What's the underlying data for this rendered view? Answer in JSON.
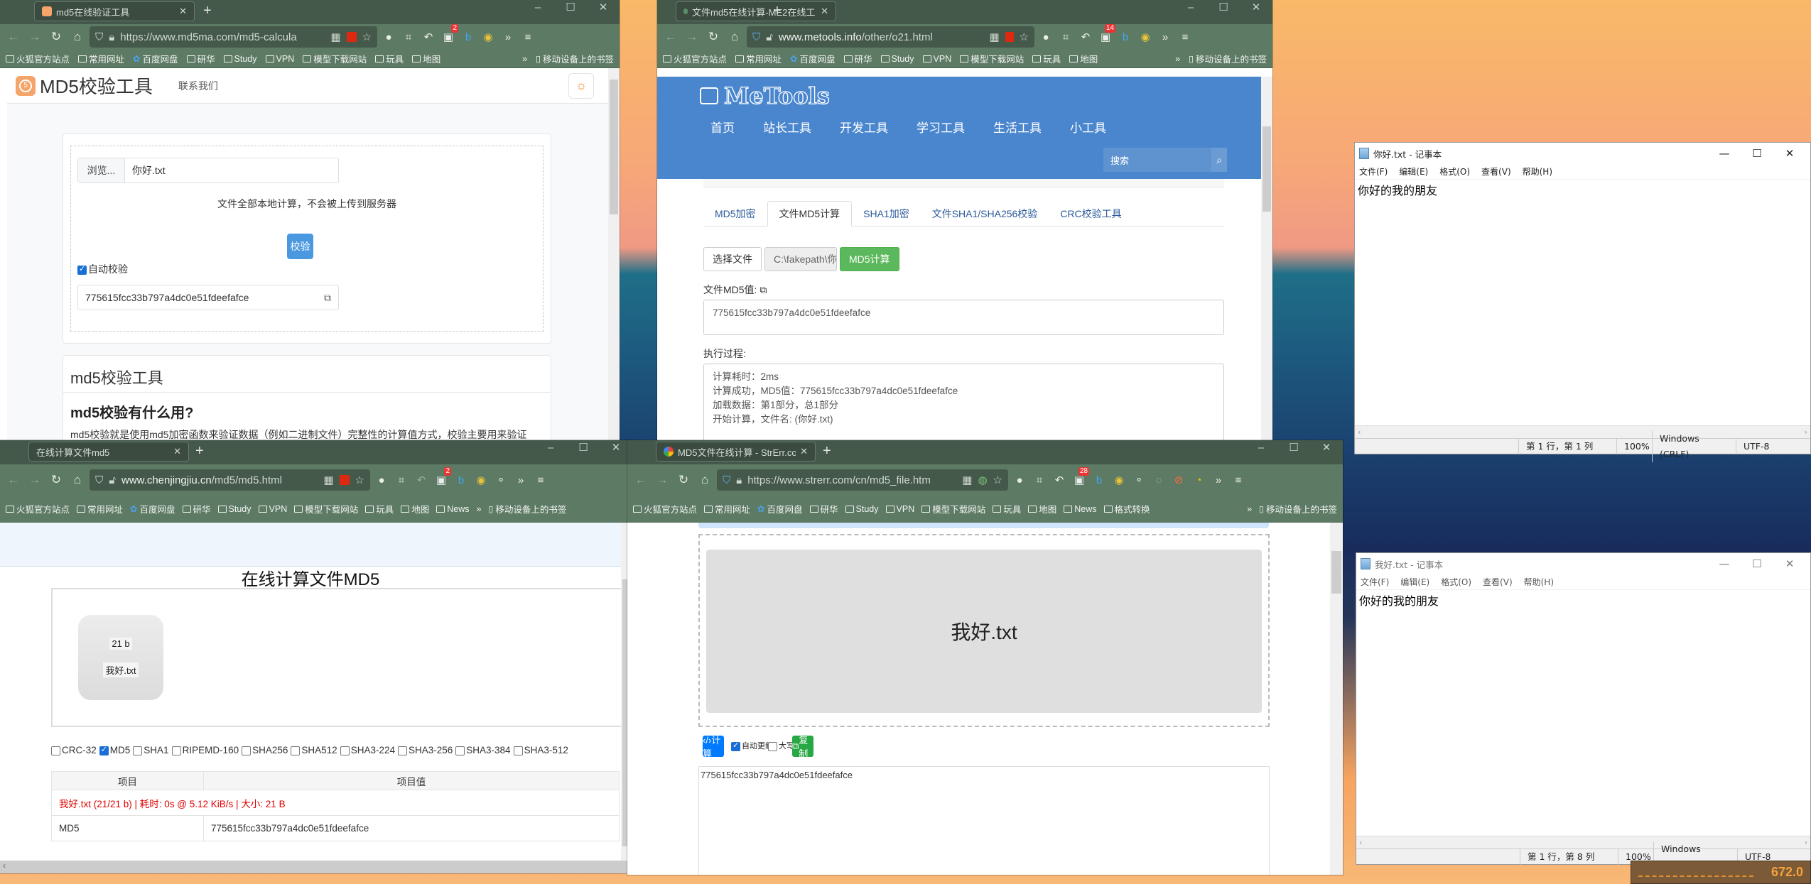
{
  "bookmarks_common": [
    "火狐官方站点",
    "常用网址",
    "百度网盘",
    "研华",
    "Study",
    "VPN",
    "模型下载网站",
    "玩具",
    "地图"
  ],
  "mobile_bookmarks": "移动设备上的书签",
  "window_md5ma": {
    "tab_title": "md5在线验证工具",
    "url": "https://www.md5ma.com/md5-calcula",
    "ext_badge": "2",
    "brand": "MD5校验工具",
    "nav_contact": "联系我们",
    "browse_label": "浏览...",
    "file_name": "你好.txt",
    "local_note": "文件全部本地计算，不会被上传到服务器",
    "verify_button": "校验",
    "auto_verify_label": "自动校验",
    "auto_verify_checked": true,
    "md5_result": "775615fcc33b797a4dc0e51fdeefafce",
    "section_title": "md5校验工具",
    "faq_heading": "md5校验有什么用?",
    "faq_text": "md5校验就是使用md5加密函数来验证数据（例如二进制文件）完整性的计算值方式，校验主要用来验证"
  },
  "window_metools": {
    "tab_title": "文件md5在线计算-ME2在线工",
    "url_host": "www.metools.info",
    "url_path": "/other/o21.html",
    "ext_badge": "14",
    "logo": "MeTools",
    "nav": [
      "首页",
      "站长工具",
      "开发工具",
      "学习工具",
      "生活工具",
      "小工具"
    ],
    "search_placeholder": "搜索",
    "tabs": [
      "MD5加密",
      "文件MD5计算",
      "SHA1加密",
      "文件SHA1/SHA256校验",
      "CRC校验工具"
    ],
    "active_tab": "文件MD5计算",
    "choose_file": "选择文件",
    "file_path": "C:\\fakepath\\你好.txt",
    "compute_button": "MD5计算",
    "md5_label": "文件MD5值:",
    "md5_value": "775615fcc33b797a4dc0e51fdeefafce",
    "process_label": "执行过程:",
    "process_lines": [
      "计算耗时：2ms",
      "计算成功，MD5值：775615fcc33b797a4dc0e51fdeefafce",
      "加载数据：第1部分，总1部分",
      "开始计算，文件名: (你好.txt)"
    ]
  },
  "notepad_1": {
    "title": "你好.txt - 记事本",
    "menu": [
      "文件(F)",
      "编辑(E)",
      "格式(O)",
      "查看(V)",
      "帮助(H)"
    ],
    "content": "你好的我的朋友",
    "status_pos": "第 1 行，第 1 列",
    "zoom": "100%",
    "line_ending": "Windows (CRLF)",
    "encoding": "UTF-8"
  },
  "notepad_2": {
    "title": "我好.txt - 记事本",
    "menu": [
      "文件(F)",
      "编辑(E)",
      "格式(O)",
      "查看(V)",
      "帮助(H)"
    ],
    "content": "你好的我的朋友",
    "status_pos": "第 1 行，第 8 列",
    "zoom": "100%",
    "line_ending": "Windows (CRLF)",
    "encoding": "UTF-8"
  },
  "window_chenjingjiu": {
    "tab_title": "在线计算文件md5",
    "url_host": "www.chenjingjiu.cn",
    "url_path": "/md5/md5.html",
    "ext_badge": "2",
    "extra_bookmark": "News",
    "page_title": "在线计算文件MD5",
    "file_size": "21 b",
    "file_name": "我好.txt",
    "algorithms": [
      {
        "label": "CRC-32",
        "checked": false
      },
      {
        "label": "MD5",
        "checked": true
      },
      {
        "label": "SHA1",
        "checked": false
      },
      {
        "label": "RIPEMD-160",
        "checked": false
      },
      {
        "label": "SHA256",
        "checked": false
      },
      {
        "label": "SHA512",
        "checked": false
      },
      {
        "label": "SHA3-224",
        "checked": false
      },
      {
        "label": "SHA3-256",
        "checked": false
      },
      {
        "label": "SHA3-384",
        "checked": false
      },
      {
        "label": "SHA3-512",
        "checked": false
      }
    ],
    "table_headers": [
      "项目",
      "项目值"
    ],
    "summary_row": "我好.txt (21/21 b) | 耗时: 0s @ 5.12 KiB/s | 大小: 21 B",
    "rows": [
      {
        "item": "MD5",
        "value": "775615fcc33b797a4dc0e51fdeefafce"
      }
    ]
  },
  "window_strerr": {
    "tab_title": "MD5文件在线计算 - StrErr.com",
    "url": "https://www.strerr.com/cn/md5_file.htm",
    "ext_badge": "28",
    "extra_bookmarks": [
      "News",
      "格式转换"
    ],
    "drop_file_name": "我好.txt",
    "compute_button": "‹/›计算",
    "auto_update_label": "自动更新",
    "auto_update_checked": true,
    "uppercase_label": "大写",
    "uppercase_checked": false,
    "copy_button": "复制",
    "result": "775615fcc33b797a4dc0e51fdeefafce"
  },
  "desktop_widget": {
    "value": "672.0"
  },
  "colors": {
    "browser_chrome": "#5d7a64",
    "titlebar": "#44594a",
    "metools_blue": "#4a86ce",
    "md5_green": "#5cb85c",
    "strerr_blue": "#007bff",
    "strerr_green": "#28a745",
    "error_red": "#e00000"
  }
}
